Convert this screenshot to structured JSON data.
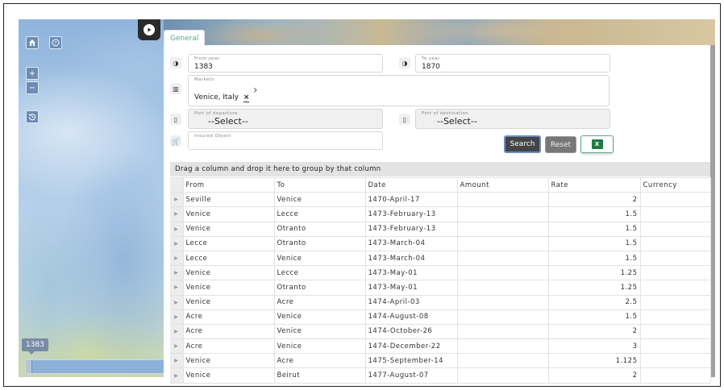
{
  "map": {
    "home_icon": "home-icon",
    "help_icon": "help-icon",
    "zoom_in": "+",
    "zoom_out": "−",
    "reset_icon": "history-icon",
    "play_icon": "play-icon",
    "slider_year": "1383"
  },
  "tab": {
    "label": "General"
  },
  "filters": {
    "from_year": {
      "label": "From year",
      "value": "1383"
    },
    "to_year": {
      "label": "To year",
      "value": "1870"
    },
    "markets": {
      "label": "Markets",
      "value": "Venice, Italy",
      "remove": "×",
      "chevron": "›"
    },
    "departure": {
      "label": "Port of departure",
      "value": "--Select--"
    },
    "destination": {
      "label": "Port of destination",
      "value": "--Select--"
    },
    "insured": {
      "label": "Insured Object",
      "value": ""
    }
  },
  "buttons": {
    "search": "Search",
    "reset": "Reset",
    "excel": "X"
  },
  "grid": {
    "group_hint": "Drag a column and drop it here to group by that column",
    "columns": [
      "From",
      "To",
      "Date",
      "Amount",
      "Rate",
      "Currency"
    ],
    "rows": [
      [
        "Seville",
        "Venice",
        "1470-April-17",
        "",
        "2",
        ""
      ],
      [
        "Venice",
        "Lecce",
        "1473-February-13",
        "",
        "1.5",
        ""
      ],
      [
        "Venice",
        "Otranto",
        "1473-February-13",
        "",
        "1.5",
        ""
      ],
      [
        "Lecce",
        "Otranto",
        "1473-March-04",
        "",
        "1.5",
        ""
      ],
      [
        "Lecce",
        "Venice",
        "1473-March-04",
        "",
        "1.5",
        ""
      ],
      [
        "Venice",
        "Lecce",
        "1473-May-01",
        "",
        "1.25",
        ""
      ],
      [
        "Venice",
        "Otranto",
        "1473-May-01",
        "",
        "1.25",
        ""
      ],
      [
        "Venice",
        "Acre",
        "1474-April-03",
        "",
        "2.5",
        ""
      ],
      [
        "Acre",
        "Venice",
        "1474-August-08",
        "",
        "1.5",
        ""
      ],
      [
        "Acre",
        "Venice",
        "1474-October-26",
        "",
        "2",
        ""
      ],
      [
        "Acre",
        "Venice",
        "1474-December-22",
        "",
        "3",
        ""
      ],
      [
        "Venice",
        "Acre",
        "1475-September-14",
        "",
        "1.125",
        ""
      ],
      [
        "Venice",
        "Beirut",
        "1477-August-07",
        "",
        "2",
        ""
      ]
    ]
  }
}
